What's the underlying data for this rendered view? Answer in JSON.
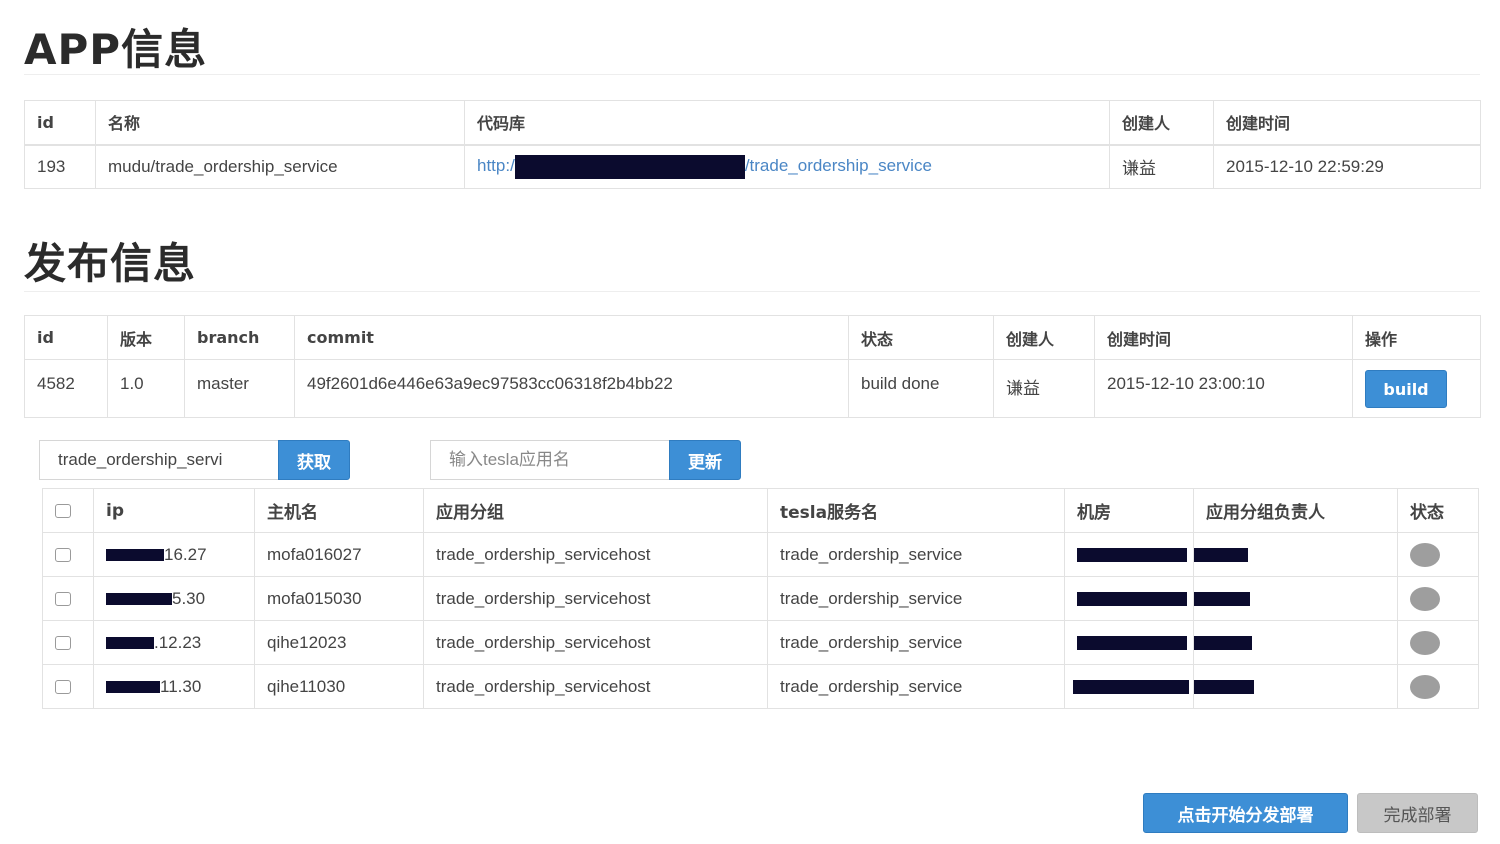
{
  "app_section": {
    "title": "APP信息",
    "headers": [
      "id",
      "名称",
      "代码库",
      "创建人",
      "创建时间"
    ],
    "row": {
      "id": "193",
      "name": "mudu/trade_ordership_service",
      "repo_prefix": "http:/",
      "repo_suffix": "/trade_ordership_service",
      "creator": "谦益",
      "created_at": "2015-12-10 22:59:29"
    }
  },
  "publish_section": {
    "title": "发布信息",
    "headers": [
      "id",
      "版本",
      "branch",
      "commit",
      "状态",
      "创建人",
      "创建时间",
      "操作"
    ],
    "row": {
      "id": "4582",
      "version": "1.0",
      "branch": "master",
      "commit": "49f2601d6e446e63a9ec97583cc06318f2b4bb22",
      "status": "build done",
      "creator": "谦益",
      "created_at": "2015-12-10 23:00:10",
      "action_label": "build"
    }
  },
  "search": {
    "value": "trade_ordership_servi",
    "button_label": "获取"
  },
  "tesla": {
    "placeholder": "输入tesla应用名",
    "button_label": "更新"
  },
  "hosts": {
    "headers": [
      "ip",
      "主机名",
      "应用分组",
      "tesla服务名",
      "机房",
      "应用分组负责人",
      "状态"
    ],
    "rows": [
      {
        "ip_suffix": "16.27",
        "hostname": "mofa016027",
        "group": "trade_ordership_servicehost",
        "tesla_service": "trade_ordership_service"
      },
      {
        "ip_suffix": "5.30",
        "hostname": "mofa015030",
        "group": "trade_ordership_servicehost",
        "tesla_service": "trade_ordership_service"
      },
      {
        "ip_suffix": ".12.23",
        "hostname": "qihe12023",
        "group": "trade_ordership_servicehost",
        "tesla_service": "trade_ordership_service"
      },
      {
        "ip_suffix": "11.30",
        "hostname": "qihe11030",
        "group": "trade_ordership_servicehost",
        "tesla_service": "trade_ordership_service"
      }
    ]
  },
  "actions": {
    "deploy_label": "点击开始分发部署",
    "finish_label": "完成部署"
  },
  "colors": {
    "primary": "#3d8fd6",
    "link": "#4a86c5",
    "redaction": "#0b0b2e",
    "status_offline": "#9e9e9e",
    "secondary_button": "#c8c8c8"
  }
}
